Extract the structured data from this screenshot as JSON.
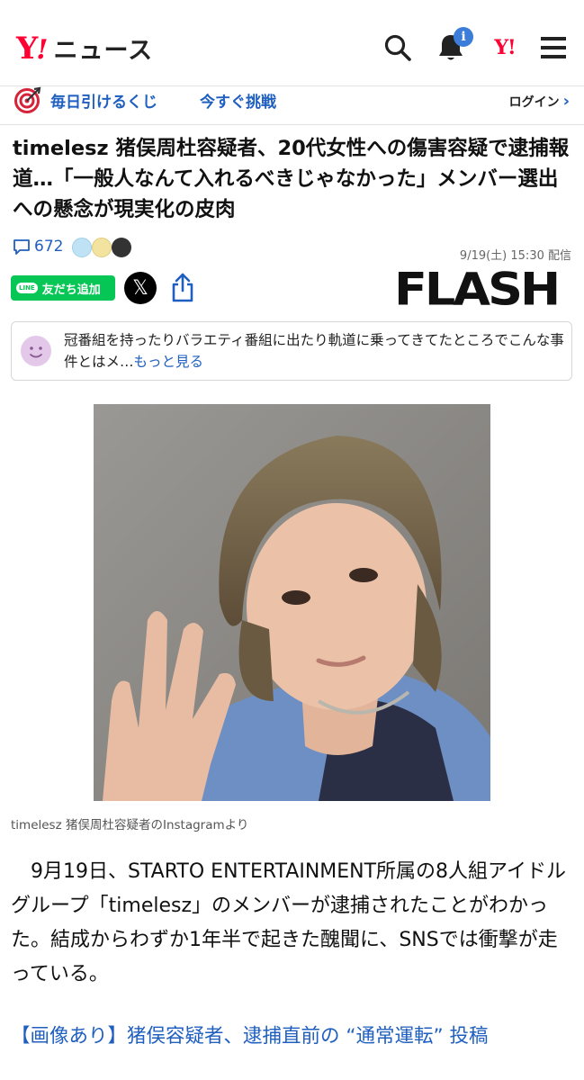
{
  "header": {
    "logo_y": "Y",
    "logo_ex": "!",
    "logo_news": "ニュース",
    "notification_badge": "i",
    "yj_label": "Y!"
  },
  "promo": {
    "lottery_label": "毎日引けるくじ",
    "cta_label": "今すぐ挑戦",
    "login_label": "ログイン",
    "login_chevron": "›"
  },
  "article": {
    "title": "timelesz 猪俣周杜容疑者、20代女性への傷害容疑で逮捕報道…「一般人なんて入れるべきじゃなかった」メンバー選出への懸念が現実化の皮肉",
    "comment_count": "672",
    "published": "9/19(土) 15:30 配信",
    "publisher": "FLASH",
    "line_button": "友だち追加",
    "line_logo": "LINE",
    "x_button": "𝕏",
    "summary_text": "冠番組を持ったりバラエティ番組に出たり軌道に乗ってきてたところでこんな事件とはメ…",
    "summary_more": "もっと見る",
    "photo_caption": "timelesz 猪俣周杜容疑者のInstagramより",
    "body": "9月19日、STARTO ENTERTAINMENT所属の8人組アイドルグループ「timelesz」のメンバーが逮捕されたことがわかった。結成からわずか1年半で起きた醜聞に、SNSでは衝撃が走っている。",
    "related_link": "【画像あり】猪俣容疑者、逮捕直前の “通常運転” 投稿"
  },
  "colors": {
    "brand_red": "#ff0033",
    "link_blue": "#1f5fbf",
    "line_green": "#06c755"
  }
}
